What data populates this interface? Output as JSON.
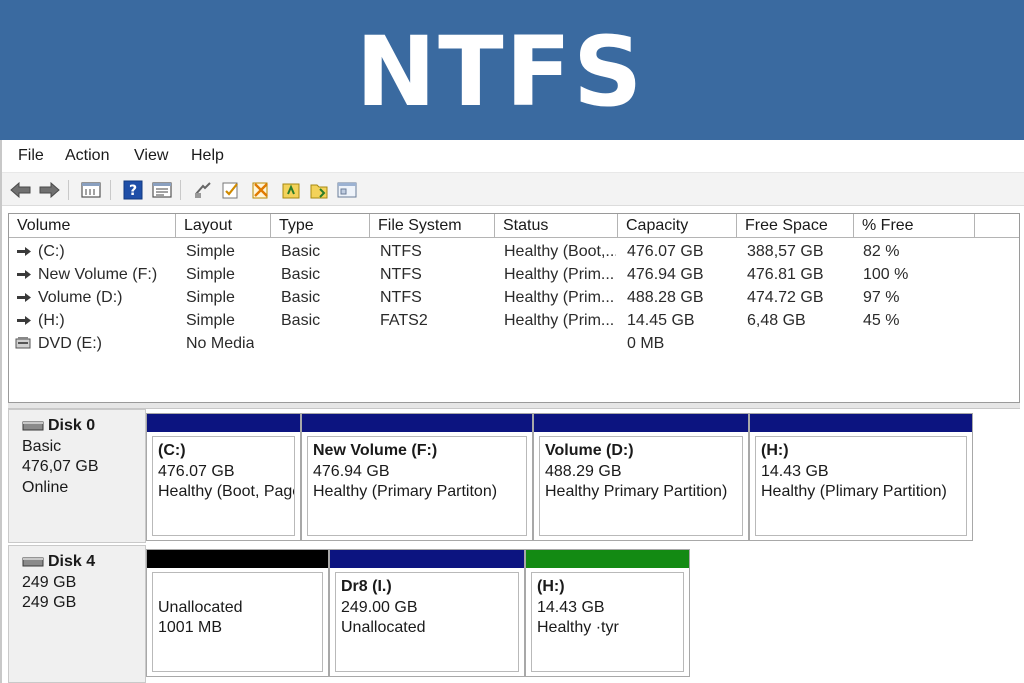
{
  "banner": {
    "title": "NTFS"
  },
  "menu": {
    "items": [
      "File",
      "Action",
      "View",
      "Help"
    ]
  },
  "toolbar": {
    "icons": [
      "back-arrow-icon",
      "forward-arrow-icon",
      "console-tree-icon",
      "help-icon",
      "properties-icon",
      "refresh-icon",
      "check-icon",
      "delete-icon",
      "new-volume-icon",
      "folder-icon",
      "settings-icon"
    ]
  },
  "volume_table": {
    "columns": [
      "Volume",
      "Layout",
      "Type",
      "File System",
      "Status",
      "Capacity",
      "Free Space",
      "% Free"
    ],
    "rows": [
      {
        "volume": "(C:)",
        "layout": "Simple",
        "type": "Basic",
        "fs": "NTFS",
        "status": "Healthy (Boot,...",
        "capacity": "476.07 GB",
        "free": "388,57 GB",
        "pct": "82 %",
        "icon": "volume-icon"
      },
      {
        "volume": "New Volume (F:)",
        "layout": "Simple",
        "type": "Basic",
        "fs": "NTFS",
        "status": "Healthy (Prim...",
        "capacity": "476.94 GB",
        "free": "476.81 GB",
        "pct": "100 %",
        "icon": "volume-icon"
      },
      {
        "volume": "Volume (D:)",
        "layout": "Simple",
        "type": "Basic",
        "fs": "NTFS",
        "status": "Healthy (Prim...",
        "capacity": "488.28 GB",
        "free": "474.72 GB",
        "pct": "97 %",
        "icon": "volume-icon"
      },
      {
        "volume": "(H:)",
        "layout": "Simple",
        "type": "Basic",
        "fs": "FATS2",
        "status": "Healthy (Prim...",
        "capacity": "14.45 GB",
        "free": "6,48 GB",
        "pct": "45 %",
        "icon": "volume-icon"
      },
      {
        "volume": "DVD (E:)",
        "layout": "No Media",
        "type": "",
        "fs": "",
        "status": "",
        "capacity": "0 MB",
        "free": "",
        "pct": "",
        "icon": "dvd-drive-icon"
      }
    ]
  },
  "disks": [
    {
      "name": "Disk 0",
      "line1": "Basic",
      "line2": "476,07 GB",
      "line3": "Online",
      "partitions": [
        {
          "title": "(C:)",
          "size": "476.07 GB",
          "status": "Healthy (Boot, Page"
        },
        {
          "title": "New Volume  (F:)",
          "size": "476.94 GB",
          "status": "Healthy (Primary Partiton)"
        },
        {
          "title": "Volume  (D:)",
          "size": "488.29 GB",
          "status": "Healthy Primary Partition)"
        },
        {
          "title": "(H:)",
          "size": "14.43 GB",
          "status": "Healthy (Plimary Partition)"
        }
      ]
    },
    {
      "name": "Disk 4",
      "line1": "249 GB",
      "line2": "249 GB",
      "line3": "",
      "partitions": [
        {
          "title": "",
          "size": "Unallocated",
          "status": "1001 MB"
        },
        {
          "title": "Dr8 (I.)",
          "size": "249.00 GB",
          "status": "Unallocated"
        },
        {
          "title": "(H:)",
          "size": "14.43 GB",
          "status": "Healthy ·tyr"
        }
      ]
    }
  ],
  "colors": {
    "banner": "#3a6aa0",
    "primary_partition": "#0c1480",
    "unallocated": "#000000",
    "healthy_green": "#138a13"
  }
}
